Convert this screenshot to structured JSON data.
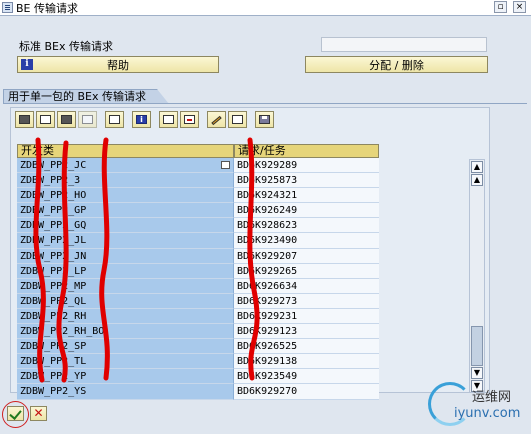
{
  "window": {
    "title": "BE 传输请求",
    "restore_glyph": "▫",
    "close_glyph": "×"
  },
  "top": {
    "label": "标准 BEx 传输请求",
    "input_value": "",
    "help_button": "帮助",
    "assign_button": "分配 / 删除"
  },
  "section": {
    "tab_label": "用于单一包的 BEx 传输请求"
  },
  "toolbar": {
    "icons": [
      "details-icon",
      "filter-icon",
      "find-icon",
      "find-next-icon",
      "print-icon",
      "info-icon",
      "insert-row-icon",
      "delete-row-icon",
      "edit-icon",
      "display-change-icon",
      "save-icon"
    ]
  },
  "table": {
    "headers": [
      "开发类",
      "请求/任务"
    ],
    "rows": [
      [
        "ZDBW_PP2_JC",
        "BD6K929289"
      ],
      [
        "ZDBW_PP2_3",
        "BD6K925873"
      ],
      [
        "ZDBW_PP2_HO",
        "BD6K924321"
      ],
      [
        "ZDBW_PP2_GP",
        "BD6K926249"
      ],
      [
        "ZDBW_PP2_GQ",
        "BD6K928623"
      ],
      [
        "ZDBW_PP2_JL",
        "BD6K923490"
      ],
      [
        "ZDBW_PP2_JN",
        "BD6K929207"
      ],
      [
        "ZDBW_PP2_LP",
        "BD6K929265"
      ],
      [
        "ZDBW_PP2_MP",
        "BD6K926634"
      ],
      [
        "ZDBW_PP2_QL",
        "BD6K929273"
      ],
      [
        "ZDBW_PP2_RH",
        "BD6K929231"
      ],
      [
        "ZDBW_PP2_RH_BO",
        "BD6K929123"
      ],
      [
        "ZDBW_PP2_SP",
        "BD6K926525"
      ],
      [
        "ZDBW_PP2_TL",
        "BD6K929138"
      ],
      [
        "ZDBW_PP2_YP",
        "BD6K923549"
      ],
      [
        "ZDBW_PP2_YS",
        "BD6K929270"
      ]
    ]
  },
  "scroll": {
    "up_glyph": "▲",
    "down_glyph": "▼"
  },
  "footer": {
    "ok_icon": "checkmark-icon",
    "cancel_glyph": "✕"
  },
  "watermark": {
    "line1": "运维网",
    "line2": "iyunv.com"
  },
  "colors": {
    "key_column": "#a8c9eb",
    "header": "#e6d57a",
    "annotation": "#e00000"
  }
}
